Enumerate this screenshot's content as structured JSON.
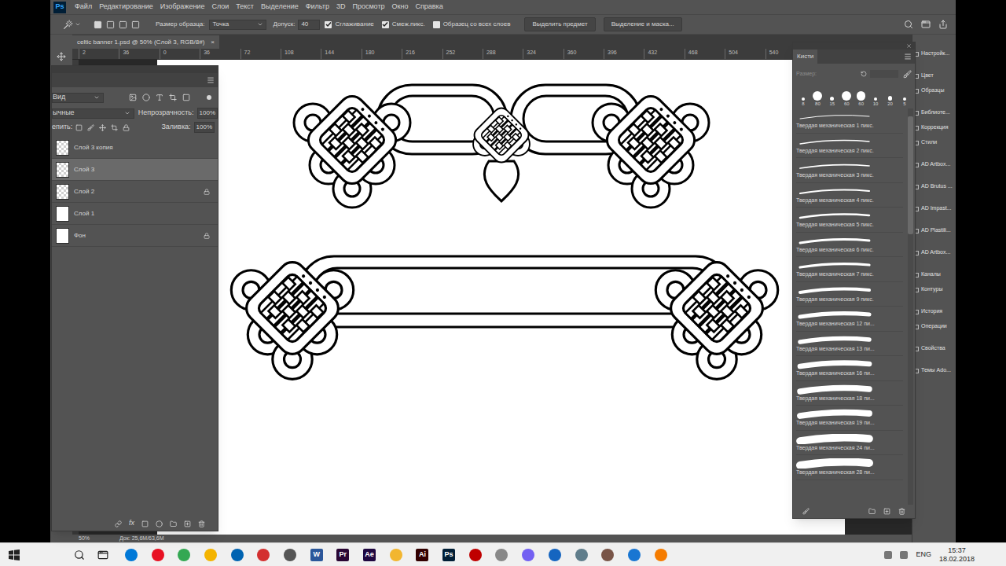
{
  "app": {
    "logo": "Ps"
  },
  "menu": [
    "Файл",
    "Редактирование",
    "Изображение",
    "Слои",
    "Текст",
    "Выделение",
    "Фильтр",
    "3D",
    "Просмотр",
    "Окно",
    "Справка"
  ],
  "options_bar": {
    "sample_size_label": "Размер образца:",
    "sample_size": "Точка",
    "tolerance_label": "Допуск:",
    "tolerance": "40",
    "checkboxes": [
      {
        "label": "Сглаживание",
        "checked": true
      },
      {
        "label": "Смеж.пикс.",
        "checked": true
      },
      {
        "label": "Образец со всех слоев",
        "checked": false
      }
    ],
    "buttons": [
      "Выделить предмет",
      "Выделение и маска..."
    ]
  },
  "document_tab": {
    "title": "celtic banner 1.psd @ 50% (Слой 3, RGB/8#)",
    "close": "×"
  },
  "ruler": [
    "2",
    "36",
    "0",
    "36",
    "72",
    "108",
    "144",
    "180",
    "216",
    "252",
    "288",
    "324",
    "360",
    "396",
    "432",
    "468",
    "504",
    "540"
  ],
  "layers_panel": {
    "filter": "Вид",
    "blend_mode": "ычные",
    "opacity_label": "Непрозрачность:",
    "opacity": "100%",
    "lock_label": "епить:",
    "fill_label": "Заливка:",
    "fill": "100%",
    "layers": [
      {
        "name": "Слой 3 копия",
        "selected": false,
        "locked": false,
        "transparent": true
      },
      {
        "name": "Слой 3",
        "selected": true,
        "locked": false,
        "transparent": true
      },
      {
        "name": "Слой 2",
        "selected": false,
        "locked": true,
        "transparent": true
      },
      {
        "name": "Слой 1",
        "selected": false,
        "locked": false,
        "transparent": false
      },
      {
        "name": "Фон",
        "selected": false,
        "locked": true,
        "transparent": false
      }
    ],
    "footer_fx": "fx"
  },
  "brushes_panel": {
    "title": "Кисти",
    "size_label": "Размер:",
    "presets": [
      "8",
      "80",
      "15",
      "60",
      "60",
      "10",
      "20",
      "5"
    ],
    "brushes": [
      "Твердая механическая 1 пикс.",
      "Твердая механическая 2 пикс.",
      "Твердая механическая 3 пикс.",
      "Твердая механическая 4 пикс.",
      "Твердая механическая 5 пикс.",
      "Твердая механическая 6 пикс.",
      "Твердая механическая 7 пикс.",
      "Твердая механическая 9 пикс.",
      "Твердая механическая 12 пи...",
      "Твердая механическая 13 пи...",
      "Твердая механическая 16 пи...",
      "Твердая механическая 18 пи...",
      "Твердая механическая 19 пи...",
      "Твердая механическая 24 пи...",
      "Твердая механическая 28 пи..."
    ]
  },
  "right_dock": [
    [
      "Настройк..."
    ],
    [
      "Цвет",
      "Образцы"
    ],
    [
      "Библиоте...",
      "Коррекция",
      "Стили"
    ],
    [
      "AD Artbox..."
    ],
    [
      "AD Brutus ..."
    ],
    [
      "AD Impast..."
    ],
    [
      "AD Plastili..."
    ],
    [
      "AD Artbox..."
    ],
    [
      "Каналы",
      "Контуры"
    ],
    [
      "История",
      "Операции"
    ],
    [
      "Свойства"
    ],
    [
      "Темы Ado..."
    ]
  ],
  "status_bar": {
    "zoom": "50%",
    "doc": "Док: 25,6M/63,6M"
  },
  "taskbar": {
    "apps": [
      {
        "kind": "icon",
        "color": "#0078d7"
      },
      {
        "kind": "icon",
        "color": "#e81123"
      },
      {
        "kind": "icon",
        "color": "#34a853"
      },
      {
        "kind": "icon",
        "color": "#f4b400"
      },
      {
        "kind": "icon",
        "color": "#0063b1"
      },
      {
        "kind": "icon",
        "color": "#d32f2f"
      },
      {
        "kind": "icon",
        "color": "#555555"
      },
      {
        "kind": "glyph",
        "label": "W",
        "color": "#2b579a"
      },
      {
        "kind": "glyph",
        "label": "Pr",
        "color": "#2a0634"
      },
      {
        "kind": "glyph",
        "label": "Ae",
        "color": "#1f0740"
      },
      {
        "kind": "icon",
        "color": "#f2b630"
      },
      {
        "kind": "glyph",
        "label": "Ai",
        "color": "#330000"
      },
      {
        "kind": "glyph",
        "label": "Ps",
        "color": "#001e36"
      },
      {
        "kind": "icon",
        "color": "#bf0000"
      },
      {
        "kind": "icon",
        "color": "#888888"
      },
      {
        "kind": "icon",
        "color": "#7360f2"
      },
      {
        "kind": "icon",
        "color": "#1565c0"
      },
      {
        "kind": "icon",
        "color": "#607d8b"
      },
      {
        "kind": "icon",
        "color": "#795548"
      },
      {
        "kind": "icon",
        "color": "#1976d2"
      },
      {
        "kind": "icon",
        "color": "#f57c00"
      }
    ],
    "language": "ENG",
    "time": "15:37",
    "date": "18.02.2018"
  }
}
